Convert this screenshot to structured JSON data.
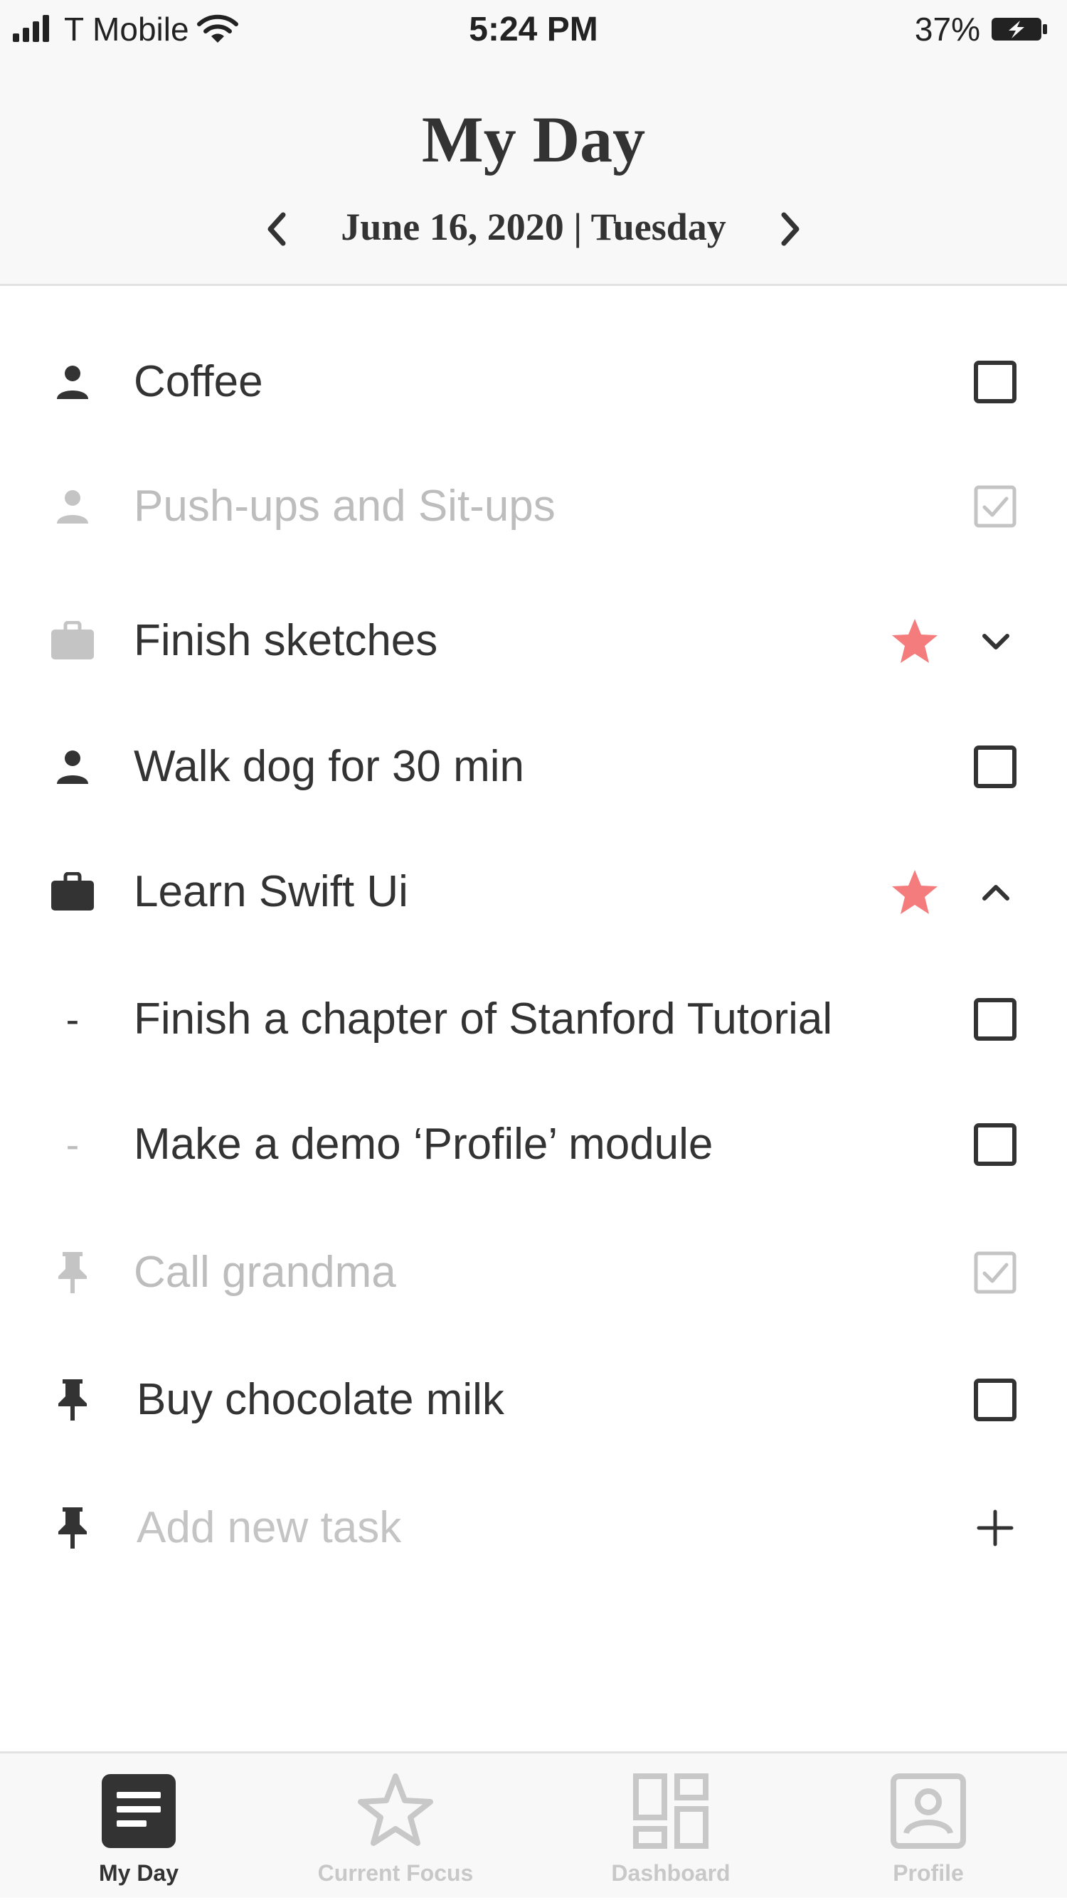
{
  "status_bar": {
    "carrier": "T Mobile",
    "time": "5:24 PM",
    "battery": "37%"
  },
  "header": {
    "title": "My Day",
    "date": "June 16, 2020 | Tuesday"
  },
  "tasks": [
    {
      "label": "Coffee",
      "icon": "person-icon",
      "state": "unchecked"
    },
    {
      "label": "Push-ups and Sit-ups",
      "icon": "person-icon",
      "state": "checked"
    },
    {
      "label": "Finish sketches",
      "icon": "briefcase-icon",
      "state": "collapsed",
      "starred": true
    },
    {
      "label": "Walk dog for 30 min",
      "icon": "person-icon",
      "state": "unchecked"
    },
    {
      "label": "Learn Swift Ui",
      "icon": "briefcase-icon",
      "state": "expanded",
      "starred": true
    },
    {
      "label": "Finish a chapter of Stanford Tutorial",
      "icon": "dash",
      "state": "unchecked",
      "subtask": true
    },
    {
      "label": "Make a demo ‘Profile’ module",
      "icon": "dash",
      "state": "unchecked",
      "subtask": true
    },
    {
      "label": "Call grandma",
      "icon": "pin-icon",
      "state": "checked"
    },
    {
      "label": "Buy chocolate milk",
      "icon": "pin-icon",
      "state": "unchecked"
    }
  ],
  "add_task": {
    "placeholder": "Add new task",
    "icon": "pin-icon"
  },
  "tabbar": {
    "items": [
      {
        "label": "My Day",
        "icon": "document-icon",
        "active": true
      },
      {
        "label": "Current Focus",
        "icon": "star-outline-icon",
        "active": false
      },
      {
        "label": "Dashboard",
        "icon": "dashboard-icon",
        "active": false
      },
      {
        "label": "Profile",
        "icon": "profile-icon",
        "active": false
      }
    ]
  },
  "colors": {
    "text": "#333333",
    "muted": "#bdbdbd",
    "star": "#f47c7c",
    "header_bg": "#f8f8f8"
  }
}
